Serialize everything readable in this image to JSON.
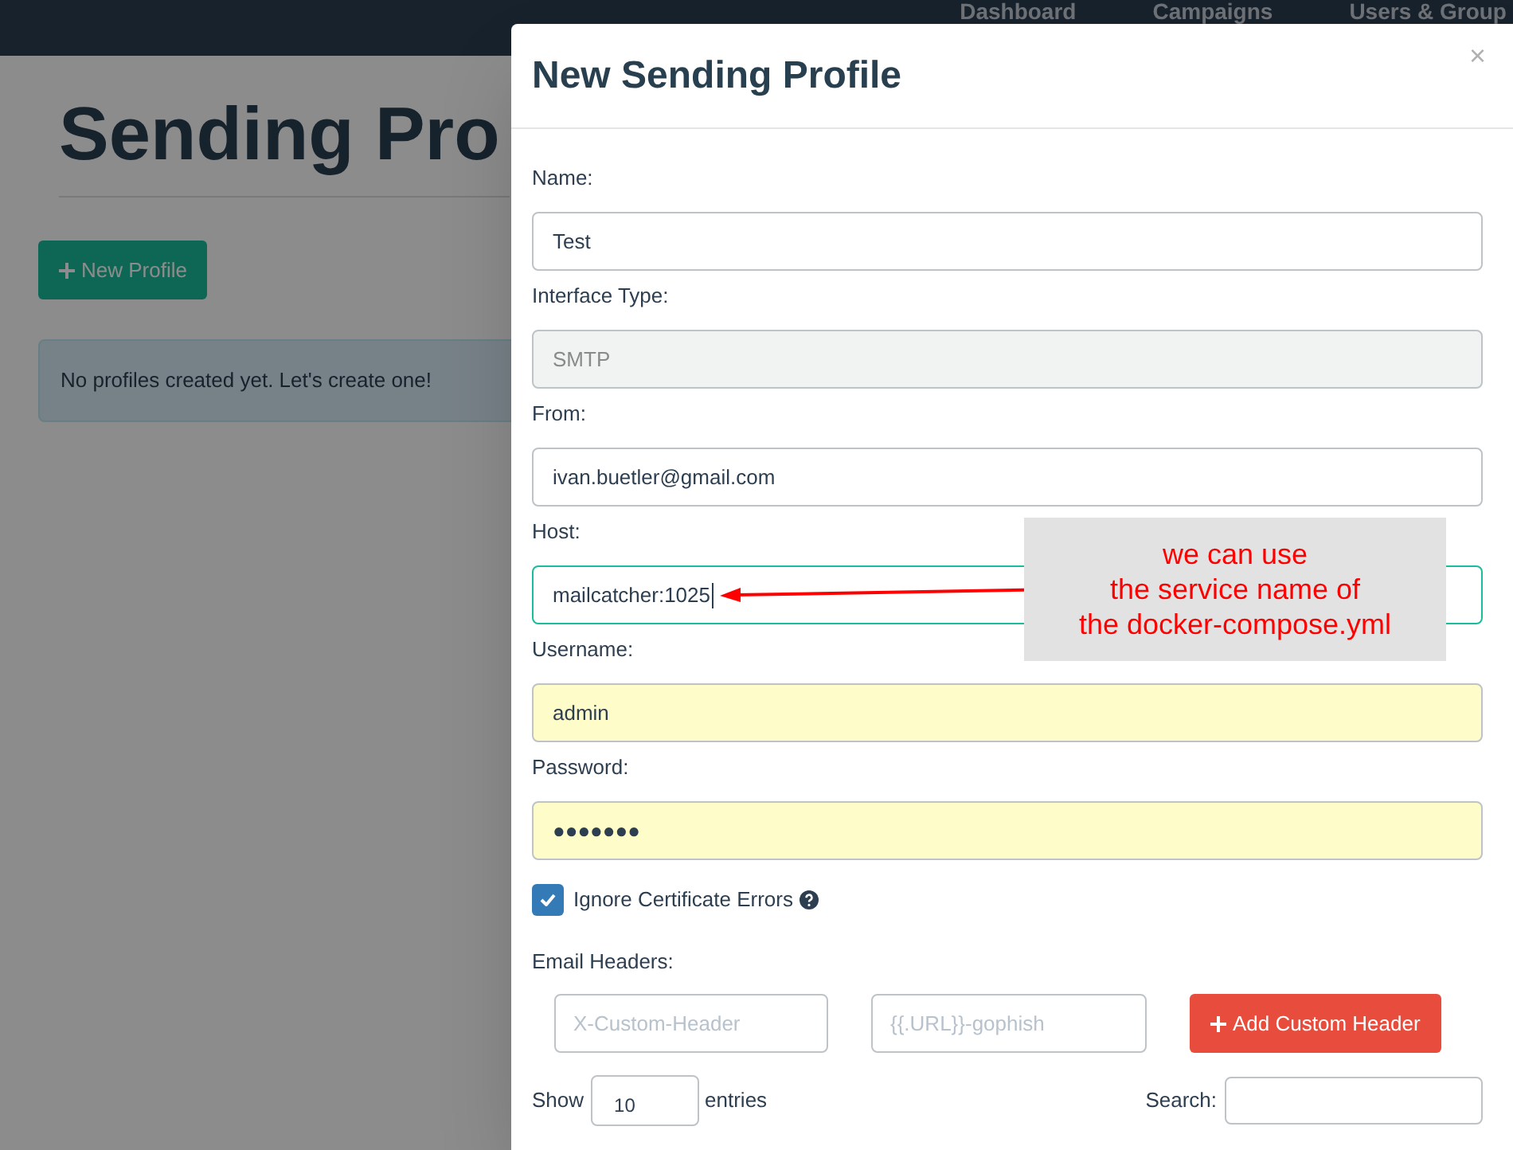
{
  "navbar": {
    "items": [
      "Dashboard",
      "Campaigns",
      "Users & Group"
    ]
  },
  "page": {
    "title": "Sending Pro",
    "new_button": "New Profile",
    "alert": "No profiles created yet. Let's create one!"
  },
  "modal": {
    "title": "New Sending Profile",
    "close": "×",
    "fields": [
      {
        "label": "Name:",
        "value": "Test",
        "disabled": false,
        "focused": false,
        "autofilled": false
      },
      {
        "label": "Interface Type:",
        "value": "SMTP",
        "disabled": true,
        "focused": false,
        "autofilled": false
      },
      {
        "label": "From:",
        "value": "ivan.buetler@gmail.com",
        "disabled": false,
        "focused": false,
        "autofilled": false
      },
      {
        "label": "Host:",
        "value": "mailcatcher:1025",
        "disabled": false,
        "focused": true,
        "autofilled": false
      },
      {
        "label": "Username:",
        "value": "admin",
        "disabled": false,
        "focused": false,
        "autofilled": true
      },
      {
        "label": "Password:",
        "value": "●●●●●●●",
        "disabled": false,
        "focused": false,
        "autofilled": true
      }
    ],
    "ignore_cert": {
      "label": "Ignore Certificate Errors",
      "checked": true
    },
    "email_headers": {
      "label": "Email Headers:",
      "header_placeholder": "X-Custom-Header",
      "value_placeholder": "{{.URL}}-gophish",
      "add_button": "Add Custom Header"
    },
    "table_controls": {
      "show": "Show",
      "length": "10",
      "entries": "entries",
      "search": "Search:"
    }
  },
  "annotation": {
    "text": "we can use\nthe service name of\nthe docker-compose.yml"
  }
}
